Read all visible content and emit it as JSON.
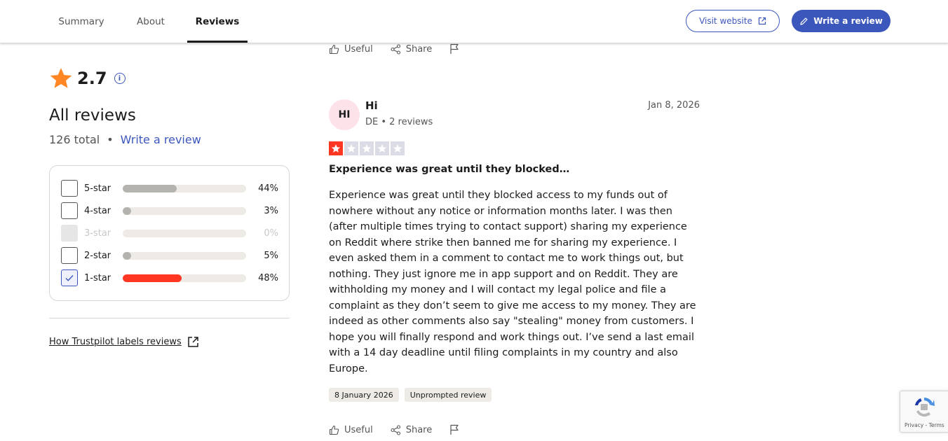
{
  "nav": {
    "tabs": [
      {
        "label": "Summary"
      },
      {
        "label": "About"
      },
      {
        "label": "Reviews"
      }
    ],
    "visit_label": "Visit website",
    "write_label": "Write a review"
  },
  "summary": {
    "rating": "2.7",
    "heading": "All reviews",
    "total": "126 total",
    "separator": "•",
    "write_link": "Write a review",
    "filters": [
      {
        "label": "5-star",
        "percent": "44%",
        "fraction": 0.44,
        "state": "unchecked"
      },
      {
        "label": "4-star",
        "percent": "3%",
        "fraction": 0.03,
        "state": "unchecked"
      },
      {
        "label": "3-star",
        "percent": "0%",
        "fraction": 0.0,
        "state": "disabled"
      },
      {
        "label": "2-star",
        "percent": "5%",
        "fraction": 0.05,
        "state": "unchecked"
      },
      {
        "label": "1-star",
        "percent": "48%",
        "fraction": 0.48,
        "state": "checked"
      }
    ],
    "labels_link": "How Trustpilot labels reviews"
  },
  "actions": {
    "useful": "Useful",
    "share": "Share"
  },
  "review": {
    "initials": "HI",
    "name": "Hi",
    "meta": "DE • 2 reviews",
    "date": "Jan 8, 2026",
    "stars": 1,
    "title": "Experience was great until they blocked…",
    "body": "Experience was great until they blocked access to my funds out of nowhere without any notice or information months later. I was then (after multiple times trying to contact support) sharing my experience on Reddit where strike then banned me for sharing my experience. I even asked them in a comment to contact me to work things out, but nothing. They just ignore me in app support and on Reddit. They are withholding my money and I will contact my legal police and file a complaint as they don’t seem to give me access to my money. They are indeed as other comments also say \"stealing\" money from customers. I hope you will finally respond and work things out. I’ve send a last email with a 14 day deadline until filing complaints in my country and also Europe.",
    "tag_date": "8 January 2026",
    "tag_type": "Unprompted review"
  },
  "recaptcha": {
    "text": "Privacy - Terms"
  },
  "colors": {
    "brand_blue": "#3c57bc",
    "star_orange": "#ff8622",
    "one_star_red": "#ff3722"
  }
}
